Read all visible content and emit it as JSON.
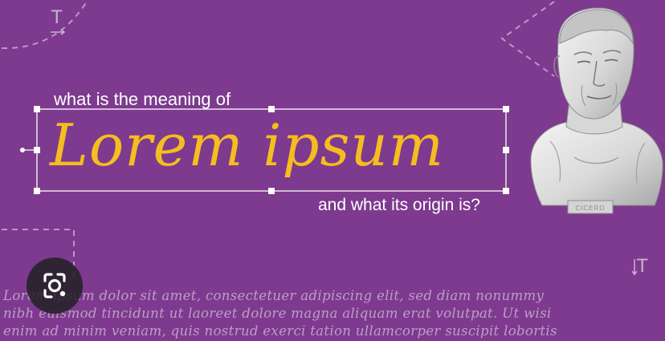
{
  "banner": {
    "question_prefix": "what is the meaning of",
    "headline": "Lorem ipsum",
    "question_suffix": "and what its origin is?",
    "bust_caption": "CICERO",
    "text_tool_glyph": "T",
    "body_lines": [
      "Lorem ipsum dolor sit amet, consectetuer adipiscing elit, sed diam nonummy",
      "nibh euismod tincidunt ut laoreet dolore magna aliquam erat volutpat. Ut wisi",
      "enim ad minim veniam, quis nostrud exerci tation ullamcorper suscipit lobortis"
    ]
  },
  "lens_button": {
    "icon": "camera-lens-icon"
  },
  "colors": {
    "background": "#7d3a8e",
    "headline": "#f5bd1f",
    "question_text": "#ffffff",
    "selection_box": "#ffffff",
    "dashed_guides": "#c9b2d3",
    "body_text": "#e8d6ee",
    "lens_button_bg": "#202124"
  }
}
